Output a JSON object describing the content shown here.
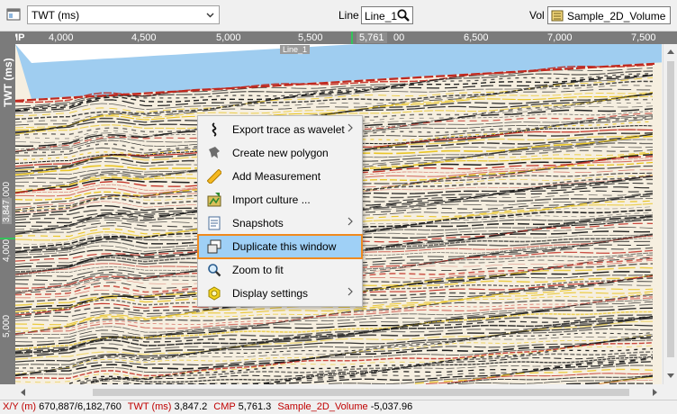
{
  "toolbar": {
    "domain_selector": "TWT (ms)",
    "line_label": "Line",
    "line_value": "Line_1",
    "vol_label": "Vol",
    "vol_value": "Sample_2D_Volume",
    "icons": [
      "window-icon",
      "chevron-down-icon",
      "magnifier-icon",
      "volume-icon"
    ]
  },
  "horizontal_axis": {
    "title": "CMP",
    "ticks": [
      "4,000",
      "4,500",
      "5,000",
      "5,500",
      "5,761",
      "00",
      "6,500",
      "7,000",
      "7,500"
    ],
    "line_tag": "Line_1"
  },
  "vertical_axis": {
    "title": "TWT (ms)",
    "ticks": [
      "3,000",
      "3,847",
      "4,000",
      "5,000"
    ]
  },
  "context_menu": {
    "items": [
      {
        "label": "Export trace as wavelet",
        "icon": "wavelet-icon",
        "submenu": true
      },
      {
        "label": "Create new polygon",
        "icon": "polygon-icon",
        "submenu": false
      },
      {
        "label": "Add Measurement",
        "icon": "ruler-icon",
        "submenu": false
      },
      {
        "label": "Import culture ...",
        "icon": "culture-icon",
        "submenu": false
      },
      {
        "label": "Snapshots",
        "icon": "snapshot-icon",
        "submenu": true
      },
      {
        "label": "Duplicate this window",
        "icon": "duplicate-window-icon",
        "submenu": false,
        "highlighted": true
      },
      {
        "label": "Zoom to fit",
        "icon": "zoom-icon",
        "submenu": false
      },
      {
        "label": "Display settings",
        "icon": "display-settings-icon",
        "submenu": true
      }
    ]
  },
  "status_bar": {
    "xy_key": "X/Y (m)",
    "xy_value": "670,887/6,182,760",
    "twt_key": "TWT (ms)",
    "twt_value": "3,847.2",
    "cmp_key": "CMP",
    "cmp_value": "5,761.3",
    "vol_key": "Sample_2D_Volume",
    "vol_value": "-5,037.96"
  },
  "colors": {
    "axis_bg": "#7b7b7b",
    "accent_marker": "#34c35a",
    "status_key": "#c00000",
    "menu_highlight": "#9fd0f6",
    "menu_highlight_border": "#f08a1e",
    "seismic_positive": "#c0281e",
    "seismic_peak": "#e8c21a",
    "seismic_negative": "#1a1a1a",
    "seismic_background": "#f6efe0",
    "overburden": "#9fcdf0"
  }
}
